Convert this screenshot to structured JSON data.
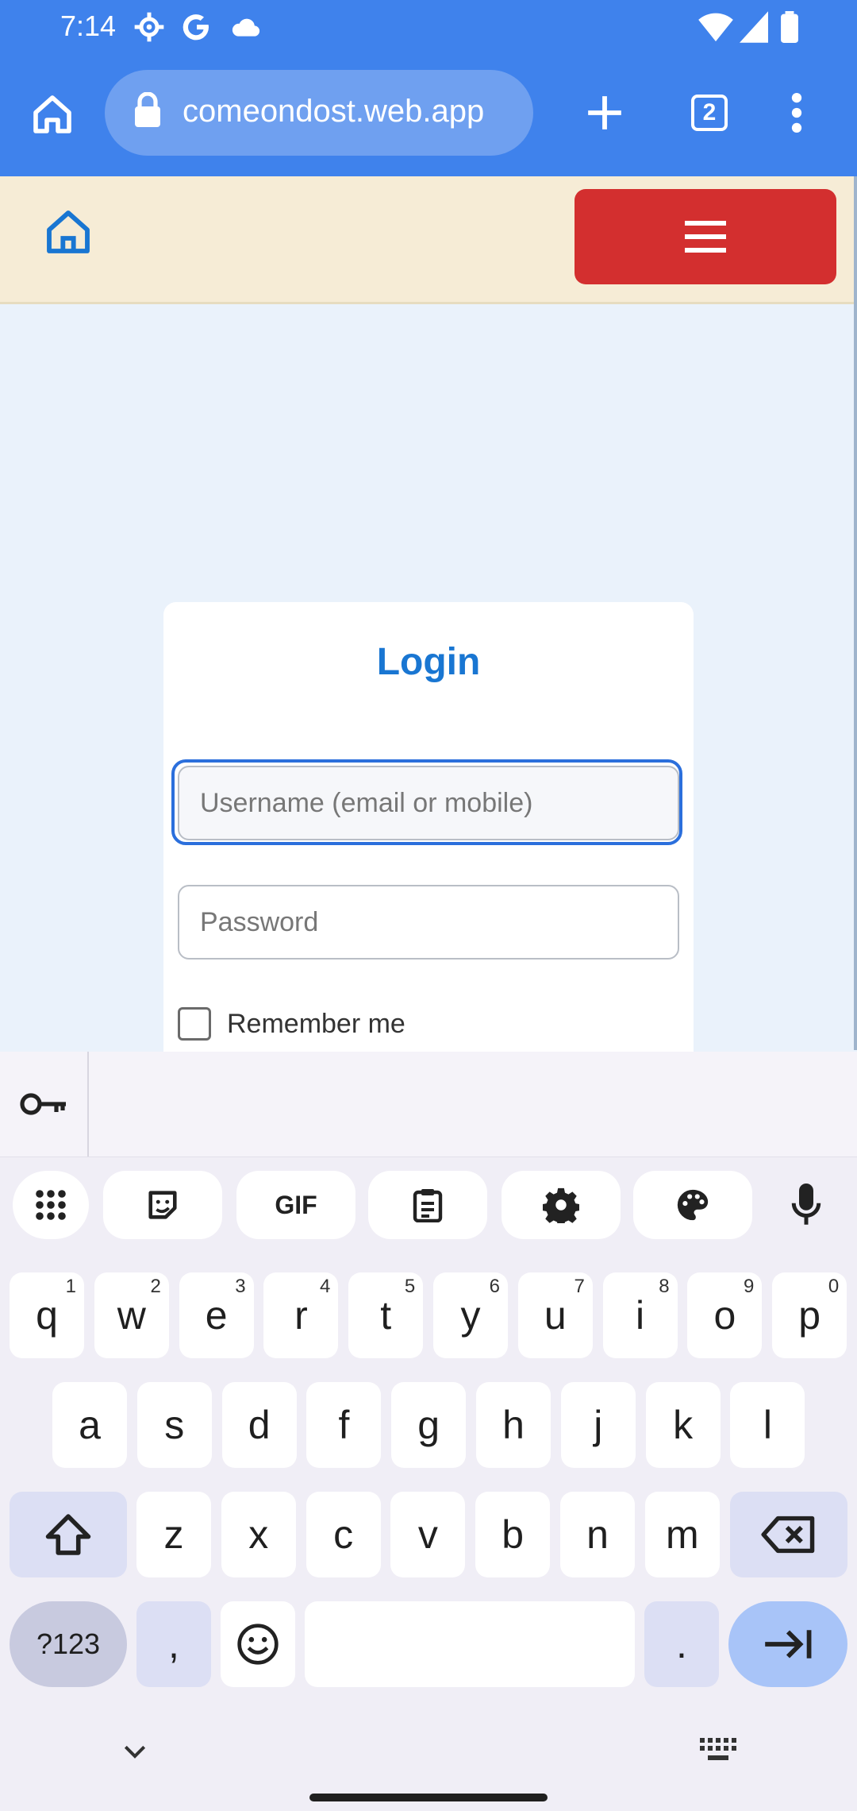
{
  "status_bar": {
    "time": "7:14"
  },
  "browser": {
    "url": "comeondost.web.app",
    "tab_count": "2"
  },
  "login": {
    "title": "Login",
    "username_placeholder": "Username (email or mobile)",
    "password_placeholder": "Password",
    "remember_label": "Remember me"
  },
  "keyboard": {
    "gif_label": "GIF",
    "row1": [
      {
        "k": "q",
        "n": "1"
      },
      {
        "k": "w",
        "n": "2"
      },
      {
        "k": "e",
        "n": "3"
      },
      {
        "k": "r",
        "n": "4"
      },
      {
        "k": "t",
        "n": "5"
      },
      {
        "k": "y",
        "n": "6"
      },
      {
        "k": "u",
        "n": "7"
      },
      {
        "k": "i",
        "n": "8"
      },
      {
        "k": "o",
        "n": "9"
      },
      {
        "k": "p",
        "n": "0"
      }
    ],
    "row2": [
      "a",
      "s",
      "d",
      "f",
      "g",
      "h",
      "j",
      "k",
      "l"
    ],
    "row3": [
      "z",
      "x",
      "c",
      "v",
      "b",
      "n",
      "m"
    ],
    "symbols_label": "?123",
    "comma": ",",
    "period": "."
  }
}
